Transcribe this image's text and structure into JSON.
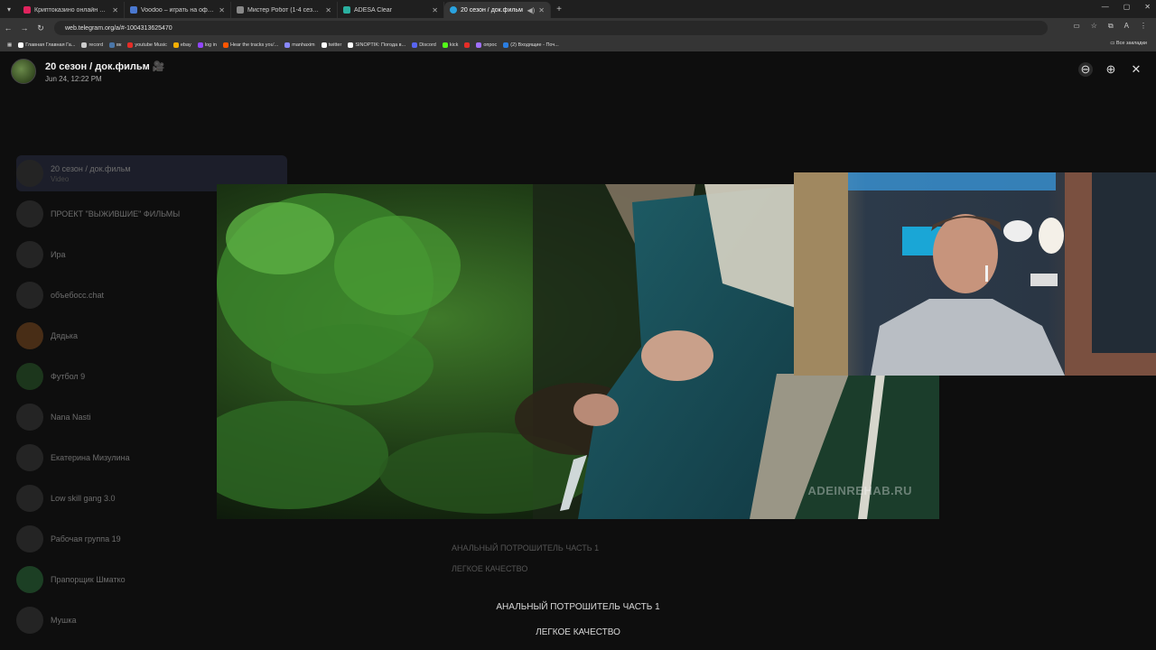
{
  "browser": {
    "tabs": [
      {
        "title": "Криптоказино онлайн VAVADA",
        "color": "#e0245e"
      },
      {
        "title": "Voodoo – играть на официальном",
        "color": "#4a78d0"
      },
      {
        "title": "Мистер Робот (1-4 сезон) смотреть",
        "color": "#888888"
      },
      {
        "title": "ADESA Clear",
        "color": "#2ab0a0"
      },
      {
        "title": "20 сезон / док.фильм",
        "color": "#2aa3e0"
      }
    ],
    "url": "web.telegram.org/a/#-1004313625470",
    "bookmarks": [
      "Главная Главная Га...",
      "record",
      "вк",
      "youtube Music",
      "ebay",
      "log in",
      "Hear the tracks you'...",
      "manhaxim",
      "twitter",
      "SINOPTIK: Погода в...",
      "Discord",
      "kick",
      "опрос",
      "(2) Входящие - Поч..."
    ],
    "bookmarks_right": "Все закладки"
  },
  "viewer": {
    "title": "20 сезон / док.фильм 🎥",
    "date": "Jun 24, 12:22 PM",
    "watermark": "ADEINREHAB.RU",
    "caption_line1": "АНАЛЬНЫЙ ПОТРОШИТЕЛЬ ЧАСТЬ 1",
    "caption_line2": "ЛЕГКОЕ КАЧЕСТВО"
  },
  "sidebar": {
    "chats": [
      {
        "name": "20 сезон / док.фильм",
        "preview": "Video"
      },
      {
        "name": "ПРОЕКТ \"ВЫЖИВШИЕ\" ФИЛЬМЫ",
        "preview": ""
      },
      {
        "name": "Ира",
        "preview": ""
      },
      {
        "name": "объебосс.chat",
        "preview": ""
      },
      {
        "name": "Дядька",
        "preview": ""
      },
      {
        "name": "Футбол 9",
        "preview": ""
      },
      {
        "name": "Nana Nasti",
        "preview": ""
      },
      {
        "name": "Екатерина Мизулина",
        "preview": ""
      },
      {
        "name": "Low skill gang 3.0",
        "preview": ""
      },
      {
        "name": "Рабочая группа 19",
        "preview": ""
      },
      {
        "name": "Прапорщик Шматко",
        "preview": ""
      },
      {
        "name": "Мушка",
        "preview": ""
      }
    ]
  }
}
